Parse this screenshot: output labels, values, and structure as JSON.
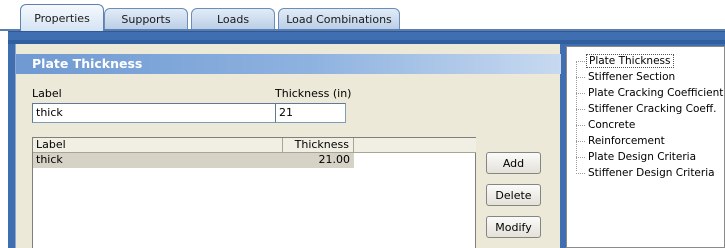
{
  "tabs": [
    {
      "label": "Properties"
    },
    {
      "label": "Supports"
    },
    {
      "label": "Loads"
    },
    {
      "label": "Load Combinations"
    }
  ],
  "section": {
    "title": "Plate Thickness"
  },
  "form": {
    "label_caption": "Label",
    "label_value": "thick",
    "thickness_caption": "Thickness (in)",
    "thickness_value": "21"
  },
  "table": {
    "columns": [
      "Label",
      "Thickness"
    ],
    "rows": [
      {
        "label": "thick",
        "thickness": "21.00"
      }
    ]
  },
  "buttons": {
    "add": "Add",
    "delete": "Delete",
    "modify": "Modify"
  },
  "tree": {
    "items": [
      "Plate Thickness",
      "Stiffener Section",
      "Plate Cracking Coefficient",
      "Stiffener Cracking Coeff.",
      "Concrete",
      "Reinforcement",
      "Plate Design Criteria",
      "Stiffener Design Criteria"
    ],
    "selected_index": 0
  },
  "colors": {
    "frame_blue": "#3f6fb0",
    "header_gradient_start": "#6f99d2",
    "panel_bg": "#ece9d8",
    "row_highlight": "#d6d2c6"
  }
}
